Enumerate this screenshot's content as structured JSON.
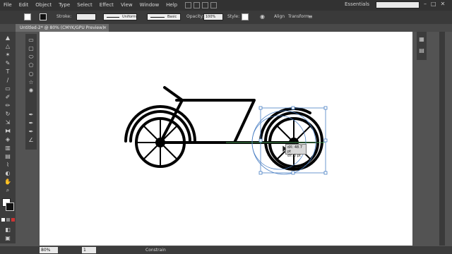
{
  "menu": {
    "items": [
      "File",
      "Edit",
      "Object",
      "Type",
      "Select",
      "Effect",
      "View",
      "Window",
      "Help"
    ],
    "workspace": "Essentials"
  },
  "controlbar": {
    "stroke_label": "Stroke:",
    "stroke_profile": "Uniform",
    "brush": "Basic",
    "opacity_label": "Opacity:",
    "opacity_value": "100%",
    "style_label": "Style:",
    "align_label": "Align",
    "transform_label": "Transform"
  },
  "document": {
    "tab_title": "Untitled-2* @ 80% (CMYK/GPU Preview)",
    "close_glyph": "×"
  },
  "status": {
    "zoom": "80%",
    "page": "1",
    "mode": "Constrain"
  },
  "tooltip": {
    "line1": "dX: 48.7 pt",
    "line2": "dY: 0 pt"
  },
  "colors": {
    "accent": "#e8892f",
    "selection": "#4a7fc4"
  }
}
